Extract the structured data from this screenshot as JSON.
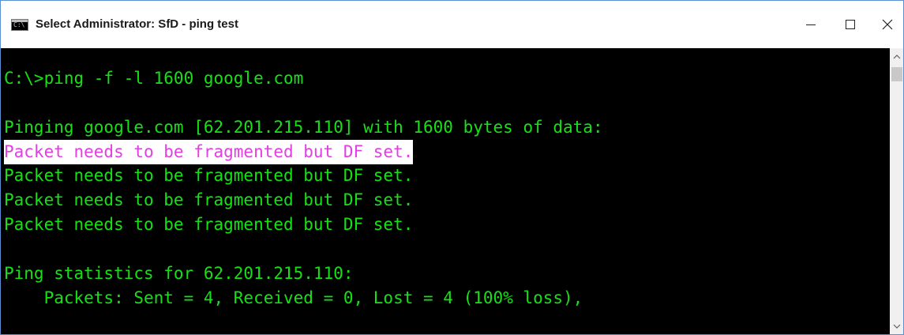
{
  "window": {
    "title": "Select Administrator: SfD - ping test",
    "icon_text": "C:\\",
    "icon": "cmd-console-icon",
    "controls": {
      "minimize_icon": "minimize-icon",
      "maximize_icon": "maximize-icon",
      "close_icon": "close-icon"
    }
  },
  "console": {
    "colors": {
      "background": "#000000",
      "text": "#16e016",
      "selection_background": "#ffffff",
      "selection_text": "#e23fe2"
    },
    "lines": [
      "C:\\>ping -f -l 1600 google.com",
      "",
      "Pinging google.com [62.201.215.110] with 1600 bytes of data:",
      "Packet needs to be fragmented but DF set.",
      "Packet needs to be fragmented but DF set.",
      "Packet needs to be fragmented but DF set.",
      "Packet needs to be fragmented but DF set.",
      "",
      "Ping statistics for 62.201.215.110:",
      "    Packets: Sent = 4, Received = 0, Lost = 4 (100% loss),"
    ],
    "selected_line_index": 3
  },
  "scrollbar": {
    "up_icon": "scroll-up-arrow-icon",
    "down_icon": "scroll-down-arrow-icon"
  }
}
